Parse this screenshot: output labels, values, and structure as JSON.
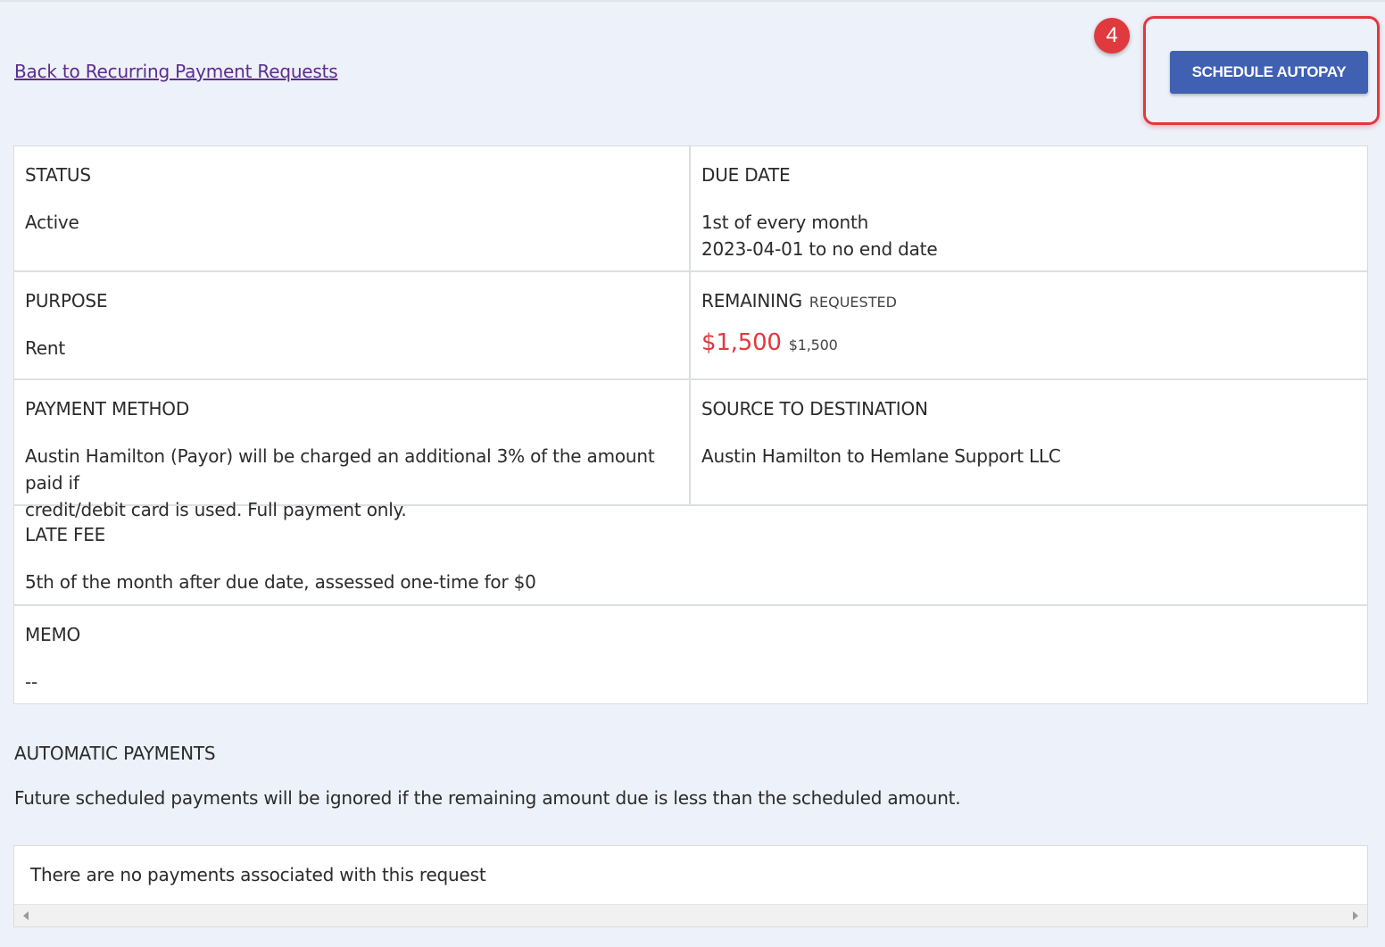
{
  "nav": {
    "back_link": "Back to Recurring Payment Requests"
  },
  "callout": {
    "step_number": "4",
    "highlight_color": "#e0393e"
  },
  "actions": {
    "schedule_autopay_label": "SCHEDULE AUTOPAY",
    "button_color": "#4060b2"
  },
  "details": {
    "status": {
      "label": "STATUS",
      "value": "Active"
    },
    "due_date": {
      "label": "DUE DATE",
      "line1": "1st of every month",
      "line2": "2023-04-01 to no end date"
    },
    "purpose": {
      "label": "PURPOSE",
      "value": "Rent"
    },
    "remaining": {
      "label": "REMAINING",
      "sublabel": "REQUESTED",
      "remaining_amount": "$1,500",
      "requested_amount": "$1,500"
    },
    "payment_method": {
      "label": "PAYMENT METHOD",
      "line1": "Austin Hamilton (Payor) will be charged an additional 3% of the amount paid if",
      "line2": "credit/debit card is used. Full payment only."
    },
    "source_destination": {
      "label": "SOURCE TO DESTINATION",
      "value": "Austin Hamilton to Hemlane Support LLC"
    },
    "late_fee": {
      "label": "LATE FEE",
      "value": "5th of the month after due date, assessed one-time for $0"
    },
    "memo": {
      "label": "MEMO",
      "value": "--"
    }
  },
  "automatic_payments": {
    "title": "AUTOMATIC PAYMENTS",
    "description": "Future scheduled payments will be ignored if the remaining amount due is less than the scheduled amount.",
    "empty_message": "There are no payments associated with this request"
  }
}
